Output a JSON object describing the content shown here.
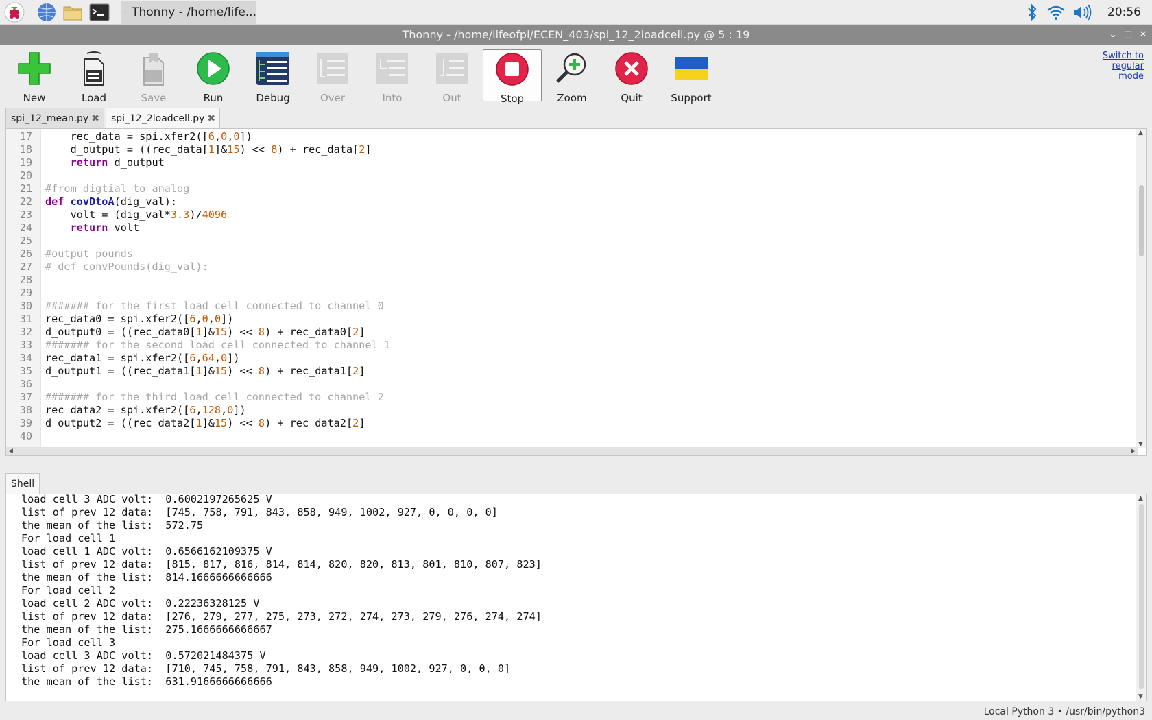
{
  "taskbar": {
    "window_button_label": "Thonny  -  /home/life...",
    "clock": "20:56",
    "icons": [
      "raspberry-menu-icon",
      "web-browser-icon",
      "file-manager-icon",
      "terminal-icon",
      "bluetooth-icon",
      "wifi-icon",
      "volume-icon"
    ]
  },
  "window": {
    "title": "Thonny  -  /home/lifeofpi/ECEN_403/spi_12_2loadcell.py  @  5 : 19"
  },
  "toolbar": {
    "buttons": [
      {
        "label": "New",
        "enabled": true
      },
      {
        "label": "Load",
        "enabled": true
      },
      {
        "label": "Save",
        "enabled": false
      },
      {
        "label": "Run",
        "enabled": true
      },
      {
        "label": "Debug",
        "enabled": true
      },
      {
        "label": "Over",
        "enabled": false
      },
      {
        "label": "Into",
        "enabled": false
      },
      {
        "label": "Out",
        "enabled": false
      },
      {
        "label": "Stop",
        "enabled": true
      },
      {
        "label": "Zoom",
        "enabled": true
      },
      {
        "label": "Quit",
        "enabled": true
      },
      {
        "label": "Support",
        "enabled": true
      }
    ],
    "switch_mode_label": "Switch to regular mode"
  },
  "tabs": [
    {
      "label": "spi_12_mean.py",
      "active": false
    },
    {
      "label": "spi_12_2loadcell.py",
      "active": true
    }
  ],
  "editor": {
    "lines": [
      {
        "n": "17",
        "code": "    rec_data = spi.xfer2([6,0,0])"
      },
      {
        "n": "18",
        "code": "    d_output = ((rec_data[1]&15) << 8) + rec_data[2]"
      },
      {
        "n": "19",
        "code": "    return d_output"
      },
      {
        "n": "20",
        "code": ""
      },
      {
        "n": "21",
        "code": "#from digtial to analog"
      },
      {
        "n": "22",
        "code": "def covDtoA(dig_val):"
      },
      {
        "n": "23",
        "code": "    volt = (dig_val*3.3)/4096"
      },
      {
        "n": "24",
        "code": "    return volt"
      },
      {
        "n": "25",
        "code": ""
      },
      {
        "n": "26",
        "code": "#output pounds"
      },
      {
        "n": "27",
        "code": "# def convPounds(dig_val):"
      },
      {
        "n": "28",
        "code": ""
      },
      {
        "n": "29",
        "code": ""
      },
      {
        "n": "30",
        "code": "####### for the first load cell connected to channel 0"
      },
      {
        "n": "31",
        "code": "rec_data0 = spi.xfer2([6,0,0])"
      },
      {
        "n": "32",
        "code": "d_output0 = ((rec_data0[1]&15) << 8) + rec_data0[2]"
      },
      {
        "n": "33",
        "code": "####### for the second load cell connected to channel 1"
      },
      {
        "n": "34",
        "code": "rec_data1 = spi.xfer2([6,64,0])"
      },
      {
        "n": "35",
        "code": "d_output1 = ((rec_data1[1]&15) << 8) + rec_data1[2]"
      },
      {
        "n": "36",
        "code": ""
      },
      {
        "n": "37",
        "code": "####### for the third load cell connected to channel 2"
      },
      {
        "n": "38",
        "code": "rec_data2 = spi.xfer2([6,128,0])"
      },
      {
        "n": "39",
        "code": "d_output2 = ((rec_data2[1]&15) << 8) + rec_data2[2]"
      },
      {
        "n": "40",
        "code": ""
      }
    ]
  },
  "shell": {
    "tab_label": "Shell",
    "lines": [
      "load cell 3 ADC volt:  0.6002197265625 V",
      "list of prev 12 data:  [745, 758, 791, 843, 858, 949, 1002, 927, 0, 0, 0, 0]",
      "the mean of the list:  572.75",
      "For load cell 1",
      "load cell 1 ADC volt:  0.6566162109375 V",
      "list of prev 12 data:  [815, 817, 816, 814, 814, 820, 820, 813, 801, 810, 807, 823]",
      "the mean of the list:  814.1666666666666",
      "For load cell 2",
      "load cell 2 ADC volt:  0.22236328125 V",
      "list of prev 12 data:  [276, 279, 277, 275, 273, 272, 274, 273, 279, 276, 274, 274]",
      "the mean of the list:  275.1666666666667",
      "For load cell 3",
      "load cell 3 ADC volt:  0.572021484375 V",
      "list of prev 12 data:  [710, 745, 758, 791, 843, 858, 949, 1002, 927, 0, 0, 0]",
      "the mean of the list:  631.9166666666666"
    ]
  },
  "statusbar": {
    "text": "Local Python 3  •  /usr/bin/python3"
  },
  "colors": {
    "keyword": "#8b008b",
    "function_name": "#1a1aa6",
    "number": "#c35a00",
    "comment": "#a6a6a6",
    "link": "#1a3aa8"
  }
}
